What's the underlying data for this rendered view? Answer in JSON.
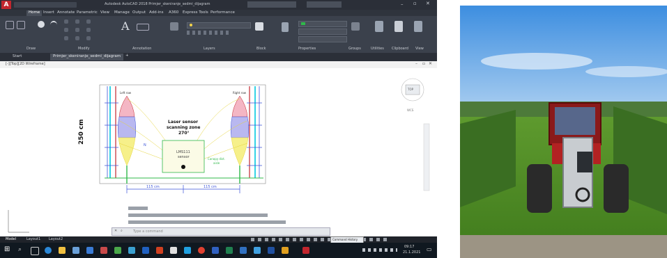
{
  "app": {
    "title": "Autodesk AutoCAD 2018   Primjer_skeniranje_sedmi_dijagram",
    "logo_letter": "A"
  },
  "ribbon": {
    "tabs": [
      "Home",
      "Insert",
      "Annotate",
      "Parametric",
      "View",
      "Manage",
      "Output",
      "Add-ins",
      "A360",
      "Express Tools",
      "Performance"
    ],
    "panels": [
      "Draw",
      "Modify",
      "Annotation",
      "Layers",
      "Block",
      "Properties",
      "Groups",
      "Utilities",
      "Clipboard",
      "View"
    ]
  },
  "file_tabs": [
    "Start",
    "Primjer_skeniranje_sedmi_dijagram"
  ],
  "viewport": {
    "label": "[-][Top][2D Wireframe]"
  },
  "diagram": {
    "height_label": "250 cm",
    "left_row_label": "Left row",
    "right_row_label": "Right row",
    "sensor_title_1": "Laser sensor",
    "sensor_title_2": "scanning zone",
    "sensor_title_3": "270°",
    "box_line_1": "LMS111",
    "box_line_2": "sensor",
    "distance_left": "115 cm",
    "distance_right": "115 cm",
    "canopy_note_1": "Canopy dist.",
    "canopy_note_2": "aisle",
    "side_marker": "N"
  },
  "navcube": {
    "face": "TOP",
    "compass": "WCS"
  },
  "commandline": {
    "placeholder": "Type a command"
  },
  "statusbar": {
    "tabs": [
      "Model",
      "Layout1",
      "Layout2"
    ]
  },
  "taskbar": {
    "tooltip": "Command History",
    "time": "09:17",
    "date": "21.1.2021"
  },
  "colors": {
    "ribbon_bg": "#3b414c",
    "canvas_bg": "#ffffff",
    "accent_red": "#c2262e",
    "cyan": "#00c8e0",
    "blue": "#3a52d8",
    "green": "#2fb84a",
    "yellow": "#e6d53a"
  }
}
